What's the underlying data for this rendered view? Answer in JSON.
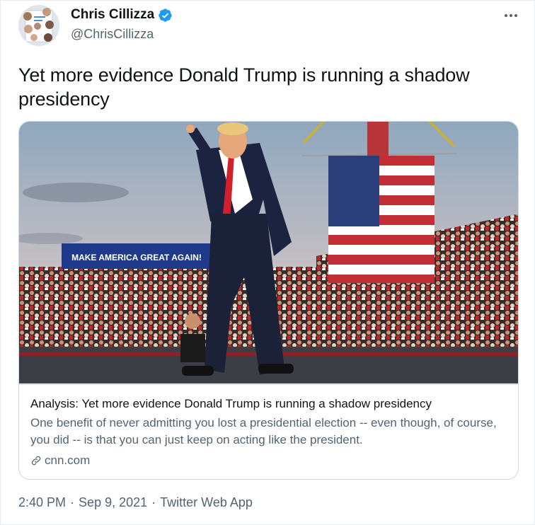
{
  "author": {
    "name": "Chris Cillizza",
    "handle": "@ChrisCillizza",
    "verified_icon": "verified-badge-icon",
    "avatar_icon": "profile-avatar"
  },
  "more_icon": "more-options-icon",
  "tweet": {
    "text": "Yet more evidence Donald Trump is running a shadow presidency"
  },
  "card": {
    "image_icon": "article-photo",
    "image_signs": {
      "banner": "MAKE AMERICA GREAT AGAIN!"
    },
    "title": "Analysis: Yet more evidence Donald Trump is running a shadow presidency",
    "description": "One benefit of never admitting you lost a presidential election -- even though, of course, you did -- is that you can just keep on acting like the president.",
    "domain": "cnn.com",
    "link_icon": "link-icon"
  },
  "meta": {
    "time": "2:40 PM",
    "separator": "·",
    "date": "Sep 9, 2021",
    "app": "Twitter Web App"
  },
  "colors": {
    "verified": "#1d9bf0",
    "secondary_text": "#536471",
    "border": "#cfd9de"
  }
}
